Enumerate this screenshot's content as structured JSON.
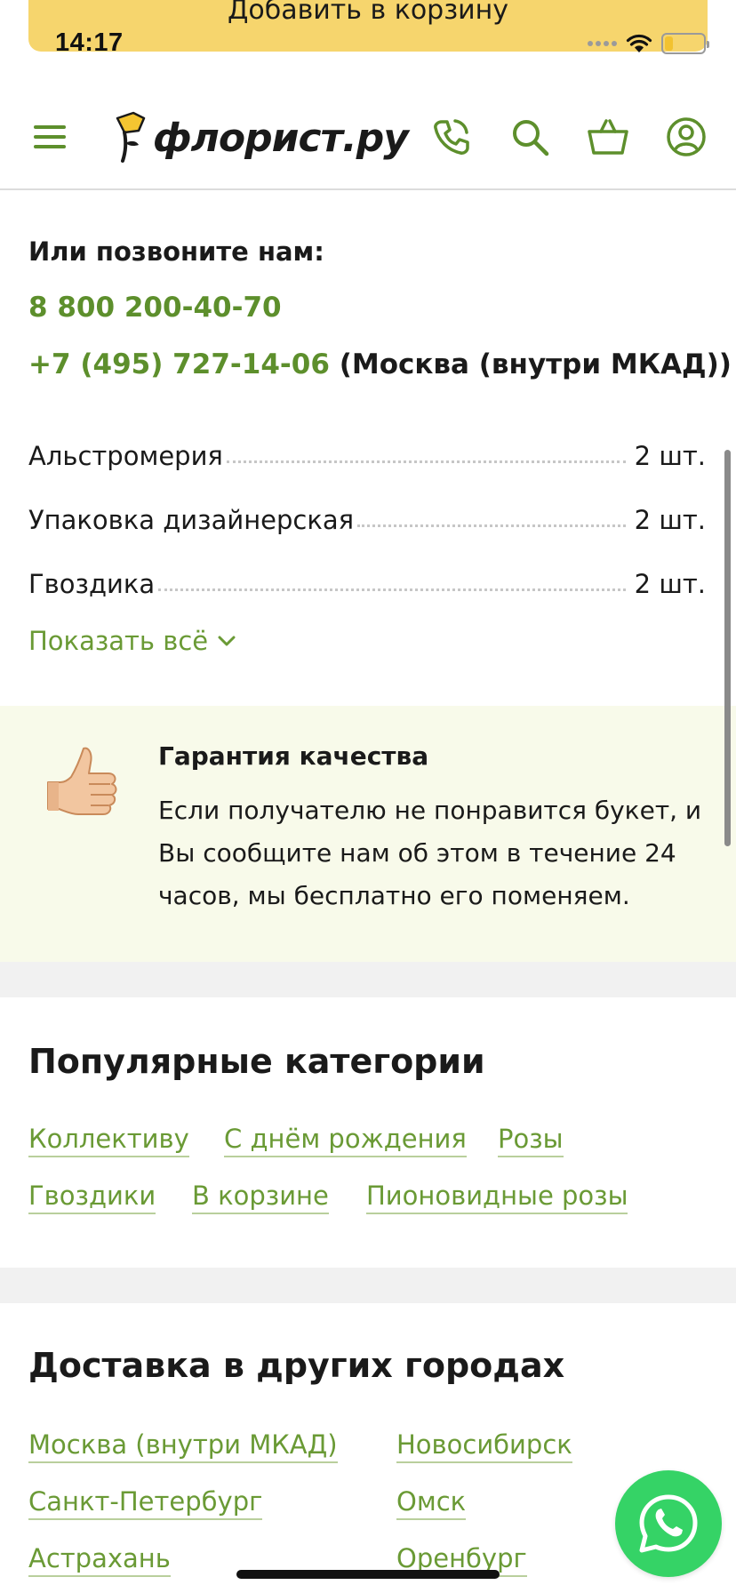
{
  "cart_strip": {
    "label": "Добавить в корзину"
  },
  "status_bar": {
    "time": "14:17"
  },
  "header": {
    "logo_text": "флорист.ру"
  },
  "contacts": {
    "title": "Или позвоните нам:",
    "phone_1": "8 800 200-40-70",
    "phone_2": "+7 (495) 727-14-06",
    "phone_2_note": " (Москва (внутри МКАД))"
  },
  "composition": {
    "items": [
      {
        "name": "Альстромерия",
        "qty": "2 шт."
      },
      {
        "name": "Упаковка дизайнерская",
        "qty": "2 шт."
      },
      {
        "name": "Гвоздика",
        "qty": "2 шт."
      }
    ],
    "show_all": "Показать всё"
  },
  "guarantee": {
    "title": "Гарантия качества",
    "line_1": "Если получателю не понравится букет, и",
    "line_2": "Вы сообщите нам об этом в течение 24",
    "line_3": "часов, мы бесплатно его поменяем."
  },
  "popular_categories": {
    "title": "Популярные категории",
    "links": [
      "Коллективу",
      "С днём рождения",
      "Розы",
      "Гвоздики",
      "В корзине",
      "Пионовидные розы"
    ]
  },
  "delivery_cities": {
    "title": "Доставка в других городах",
    "links": [
      "Москва (внутри МКАД)",
      "Новосибирск",
      "Санкт-Петербург",
      "Омск",
      "Астрахань",
      "Оренбург"
    ]
  },
  "colors": {
    "accent_green": "#5d8f2c",
    "link_green": "#6a9a35",
    "cart_yellow": "#f6d56d",
    "guarantee_bg": "#f8faea",
    "whatsapp_green": "#35d366"
  },
  "icons": [
    "menu-icon",
    "logo-flower-icon",
    "phone-icon",
    "search-icon",
    "basket-icon",
    "user-icon",
    "chevron-down-icon",
    "thumbs-up-icon",
    "whatsapp-icon"
  ]
}
